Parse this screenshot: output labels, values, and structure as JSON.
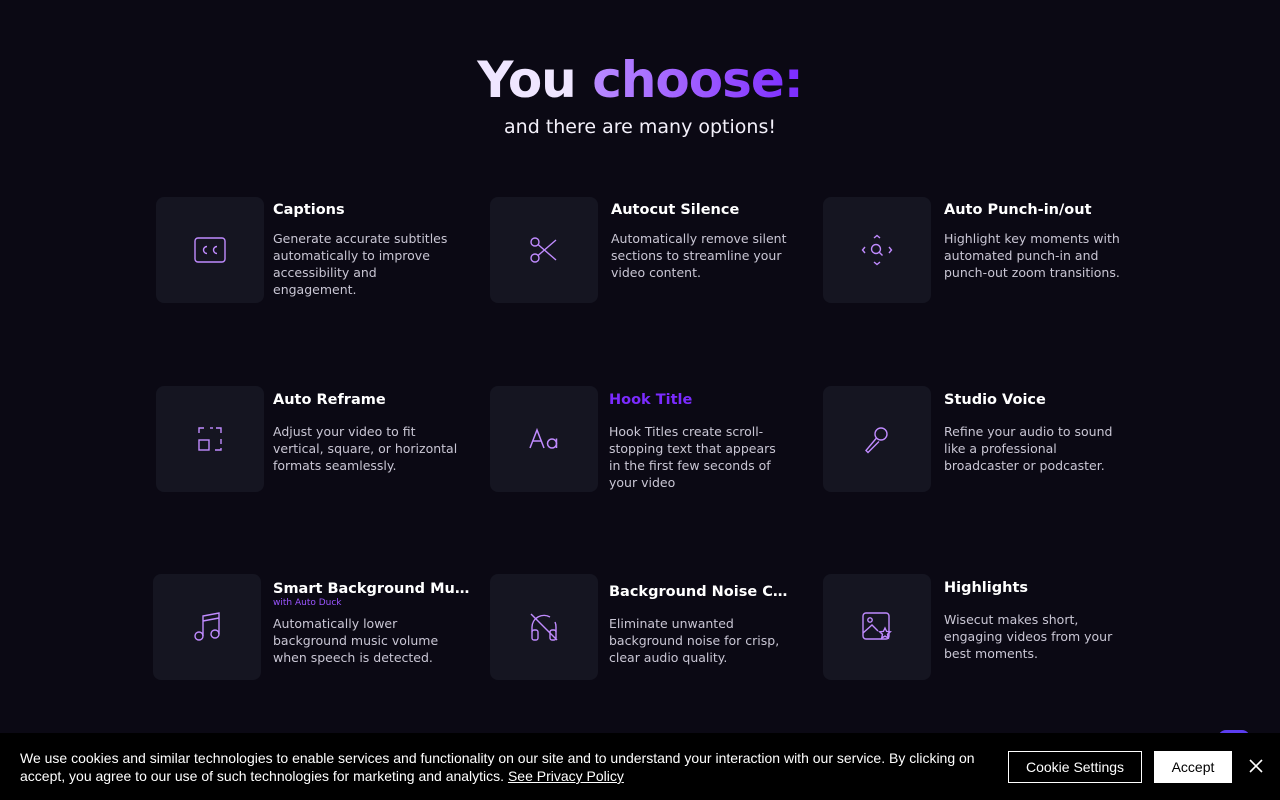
{
  "hero": {
    "title_part1": "You ",
    "title_part2": "choose:",
    "subtitle": "and there are many options!"
  },
  "features": [
    {
      "title": "Captions",
      "description": "Generate accurate subtitles automatically to improve accessibility and engagement.",
      "icon": "closed-captions-icon"
    },
    {
      "title": "Autocut Silence",
      "description": "Automatically remove silent sections to streamline your video content.",
      "icon": "scissors-icon"
    },
    {
      "title": "Auto Punch-in/out",
      "description": "Highlight key moments with automated punch-in and punch-out zoom transitions.",
      "icon": "zoom-focus-icon"
    },
    {
      "title": "Auto Reframe",
      "description": "Adjust your video to fit vertical, square, or horizontal formats seamlessly.",
      "icon": "reframe-icon"
    },
    {
      "title": "Hook Title",
      "description": "Hook Titles create scroll-stopping text that appears in the first few seconds of your video",
      "icon": "text-aa-icon"
    },
    {
      "title": "Studio Voice",
      "description": "Refine your audio to sound like a professional broadcaster or podcaster.",
      "icon": "microphone-icon"
    },
    {
      "title": "Smart Background Music",
      "tag": "with Auto Duck",
      "description": "Automatically lower background music volume when speech is detected.",
      "icon": "music-note-icon"
    },
    {
      "title": "Background Noise Canc...",
      "description": "Eliminate unwanted background noise for crisp, clear audio quality.",
      "icon": "headphones-off-icon"
    },
    {
      "title": "Highlights",
      "description": "Wisecut makes short, engaging videos from your best moments.",
      "icon": "image-star-icon"
    }
  ],
  "cookie": {
    "text": "We use cookies and similar technologies to enable services and functionality on our site and to understand your interaction with our service. By clicking on accept, you agree to our use of such technologies for marketing and analytics.",
    "privacy_link": "See Privacy Policy",
    "settings_label": "Cookie Settings",
    "accept_label": "Accept"
  },
  "colors": {
    "background": "#0b0914",
    "tile": "#151521",
    "accent": "#7b2bff",
    "icon_stroke": "#c08bff"
  }
}
